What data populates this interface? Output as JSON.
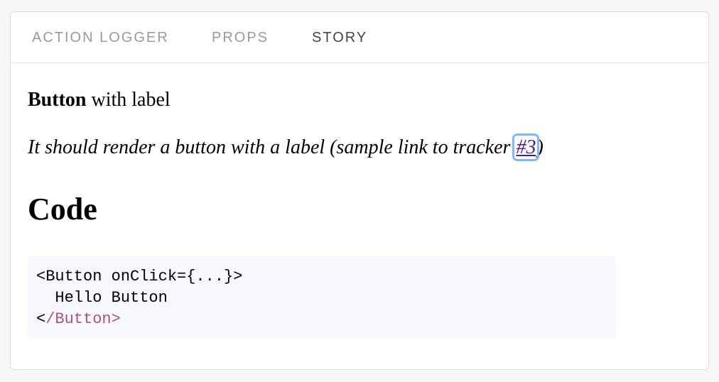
{
  "tabs": [
    {
      "label": "ACTION LOGGER"
    },
    {
      "label": "PROPS"
    },
    {
      "label": "STORY"
    }
  ],
  "story": {
    "title_bold": "Button",
    "title_rest": " with label",
    "description_text": "It should render a button with a label (sample link to tracker ",
    "description_link": "#3",
    "description_end": ")",
    "code_heading": "Code"
  },
  "code": {
    "line1": "<Button onClick={...}>",
    "line2": "  Hello Button",
    "line3_open": "<",
    "line3_tag": "/Button>"
  },
  "colors": {
    "active_tab": "#444444",
    "inactive_tab": "#9a9a9a",
    "link": "#4b1a86",
    "code_tag": "#b0517a",
    "code_bg": "#f7f8fd"
  }
}
